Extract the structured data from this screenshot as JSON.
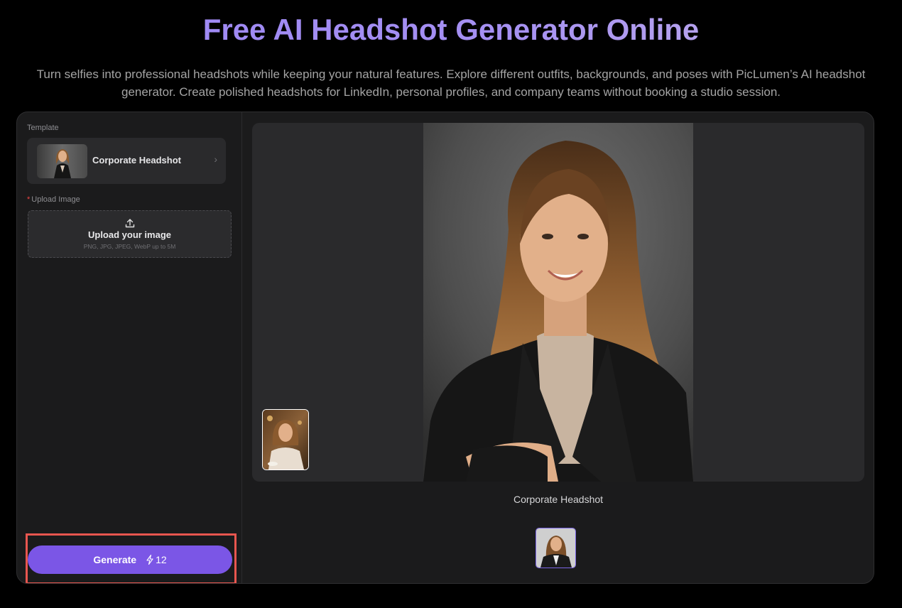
{
  "hero": {
    "title": "Free AI Headshot Generator Online",
    "subtitle": "Turn selfies into professional headshots while keeping your natural features. Explore different outfits, backgrounds, and poses with PicLumen’s AI headshot generator. Create polished headshots for LinkedIn, personal profiles, and company teams without booking a studio session."
  },
  "sidebar": {
    "template_label": "Template",
    "template": {
      "name": "Corporate Headshot",
      "chevron": "›"
    },
    "upload_label": "Upload Image",
    "required_marker": "*",
    "upload": {
      "title": "Upload your image",
      "hint": "PNG, JPG, JPEG, WebP up to 5M",
      "icon": "upload-icon"
    },
    "generate": {
      "label": "Generate",
      "credits": "12",
      "icon": "lightning-icon"
    }
  },
  "preview": {
    "caption": "Corporate Headshot"
  },
  "colors": {
    "accent": "#7b56e6",
    "highlight_outline": "#e8564f",
    "panel_bg": "#1b1b1c"
  }
}
